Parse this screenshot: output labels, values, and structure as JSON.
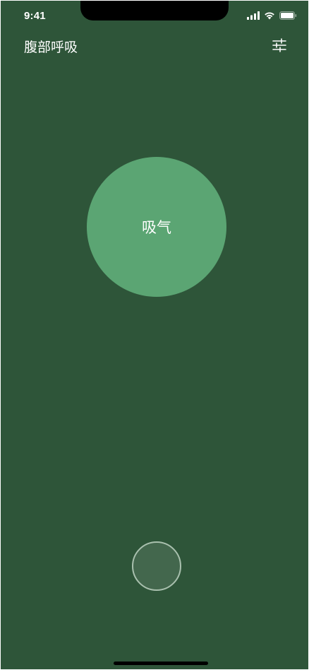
{
  "status_bar": {
    "time": "9:41",
    "icons": [
      "signal-icon",
      "wifi-icon",
      "battery-icon"
    ]
  },
  "header": {
    "title": "腹部呼吸",
    "settings_icon": "sliders-icon"
  },
  "breathing": {
    "phase_label": "吸气"
  },
  "colors": {
    "background": "#2e5539",
    "circle": "#5ba573",
    "button_fill": "#43674d",
    "button_border": "#a9c0ae"
  }
}
